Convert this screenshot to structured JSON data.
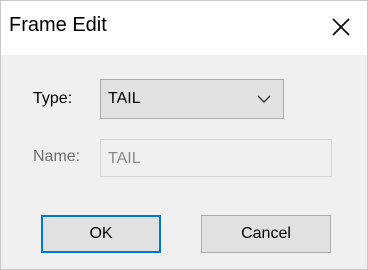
{
  "window": {
    "title": "Frame Edit",
    "close_icon": "close-icon"
  },
  "form": {
    "type_label": "Type:",
    "type_value": "TAIL",
    "type_chevron_icon": "chevron-down-icon",
    "name_label": "Name:",
    "name_value": "TAIL"
  },
  "buttons": {
    "ok_label": "OK",
    "cancel_label": "Cancel"
  },
  "colors": {
    "accent": "#0078d7",
    "dialog_background": "#f0f0f0",
    "button_background": "#e1e1e1",
    "disabled_text": "#8a8a8a"
  }
}
